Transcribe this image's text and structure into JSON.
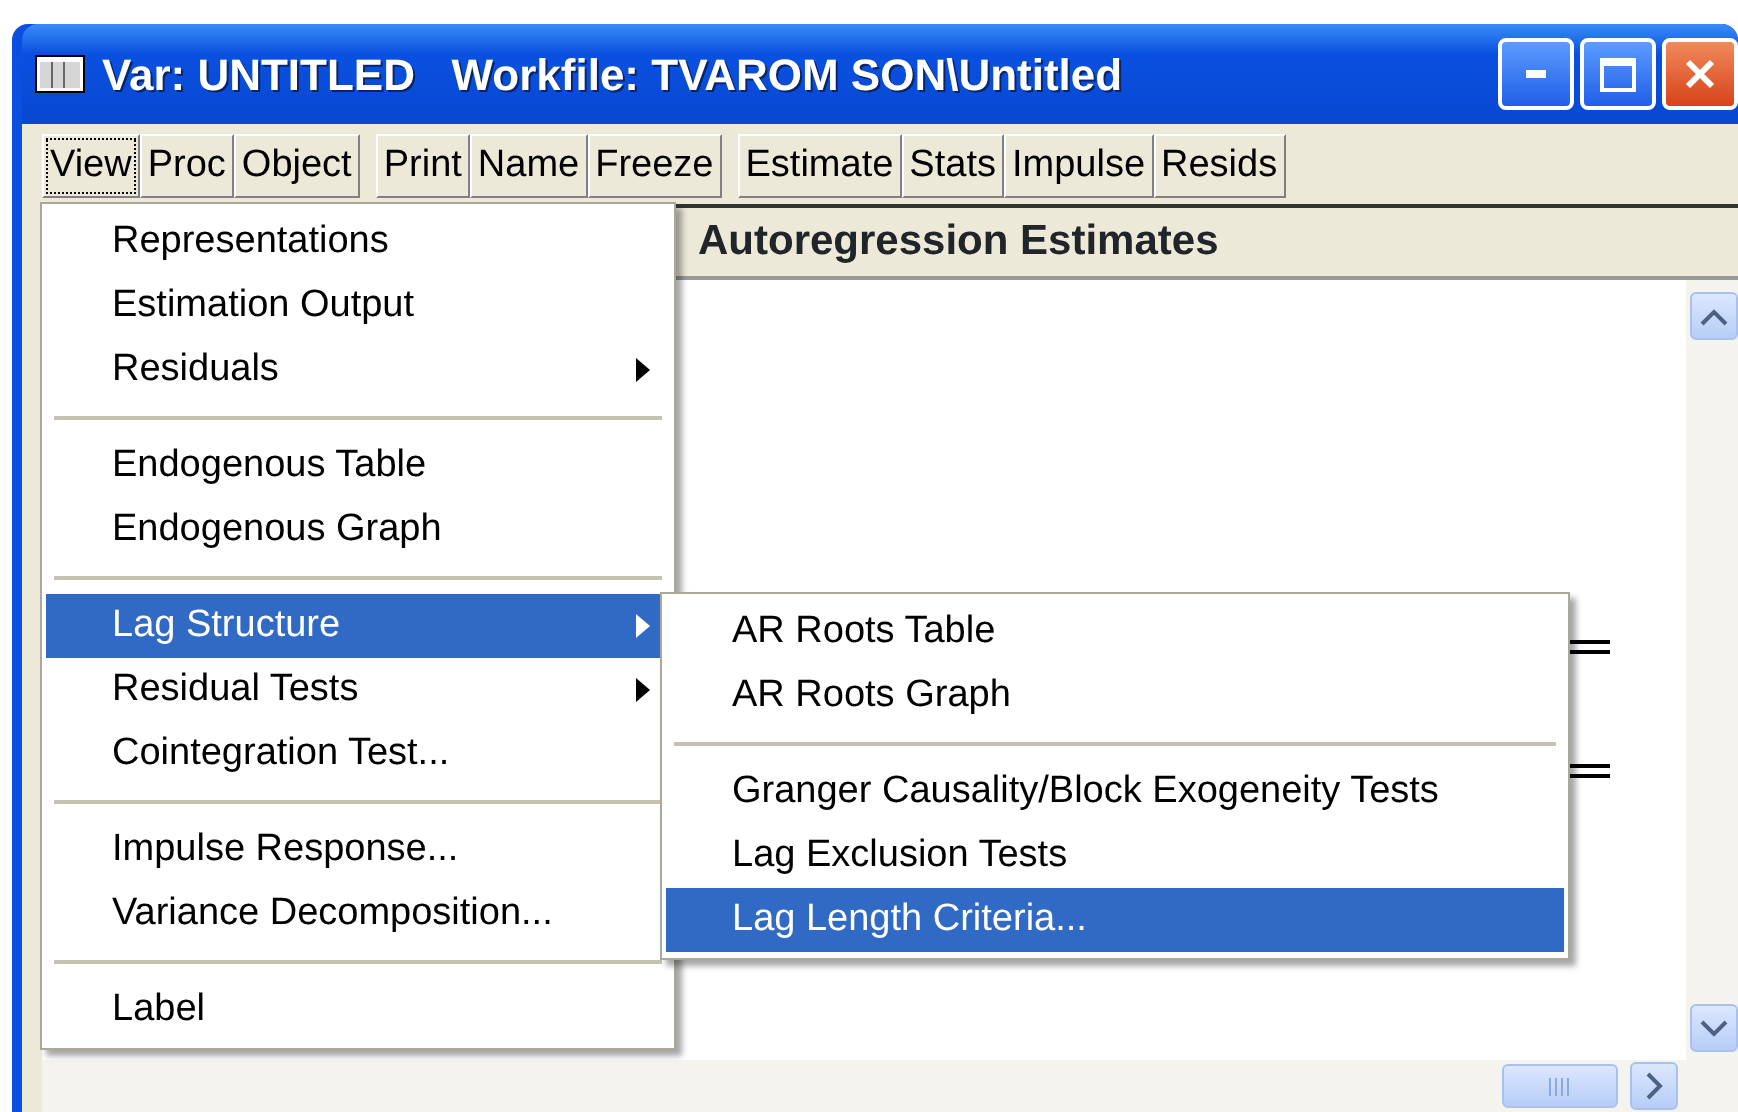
{
  "window": {
    "title": "Var: UNTITLED   Workfile: TVAROM SON\\Untitled"
  },
  "toolbar_groups": [
    [
      {
        "label": "View",
        "selected": true
      },
      {
        "label": "Proc",
        "selected": false
      },
      {
        "label": "Object",
        "selected": false
      }
    ],
    [
      {
        "label": "Print",
        "selected": false
      },
      {
        "label": "Name",
        "selected": false
      },
      {
        "label": "Freeze",
        "selected": false
      }
    ],
    [
      {
        "label": "Estimate",
        "selected": false
      },
      {
        "label": "Stats",
        "selected": false
      },
      {
        "label": "Impulse",
        "selected": false
      },
      {
        "label": "Resids",
        "selected": false
      }
    ]
  ],
  "output": {
    "heading": "Autoregression Estimates"
  },
  "view_menu": {
    "items": [
      {
        "kind": "item",
        "label": "Representations",
        "submenu": false,
        "selected": false
      },
      {
        "kind": "item",
        "label": "Estimation Output",
        "submenu": false,
        "selected": false
      },
      {
        "kind": "item",
        "label": "Residuals",
        "submenu": true,
        "selected": false
      },
      {
        "kind": "separator"
      },
      {
        "kind": "item",
        "label": "Endogenous Table",
        "submenu": false,
        "selected": false
      },
      {
        "kind": "item",
        "label": "Endogenous Graph",
        "submenu": false,
        "selected": false
      },
      {
        "kind": "separator"
      },
      {
        "kind": "item",
        "label": "Lag Structure",
        "submenu": true,
        "selected": true
      },
      {
        "kind": "item",
        "label": "Residual Tests",
        "submenu": true,
        "selected": false
      },
      {
        "kind": "item",
        "label": "Cointegration Test...",
        "submenu": false,
        "selected": false
      },
      {
        "kind": "separator"
      },
      {
        "kind": "item",
        "label": "Impulse Response...",
        "submenu": false,
        "selected": false
      },
      {
        "kind": "item",
        "label": "Variance Decomposition...",
        "submenu": false,
        "selected": false
      },
      {
        "kind": "separator"
      },
      {
        "kind": "item",
        "label": "Label",
        "submenu": false,
        "selected": false
      }
    ]
  },
  "lag_structure_menu": {
    "items": [
      {
        "kind": "item",
        "label": "AR Roots Table",
        "submenu": false,
        "selected": false
      },
      {
        "kind": "item",
        "label": "AR Roots Graph",
        "submenu": false,
        "selected": false
      },
      {
        "kind": "separator"
      },
      {
        "kind": "item",
        "label": "Granger Causality/Block Exogeneity Tests",
        "submenu": false,
        "selected": false
      },
      {
        "kind": "item",
        "label": "Lag Exclusion Tests",
        "submenu": false,
        "selected": false
      },
      {
        "kind": "item",
        "label": "Lag Length Criteria...",
        "submenu": false,
        "selected": true
      }
    ]
  }
}
